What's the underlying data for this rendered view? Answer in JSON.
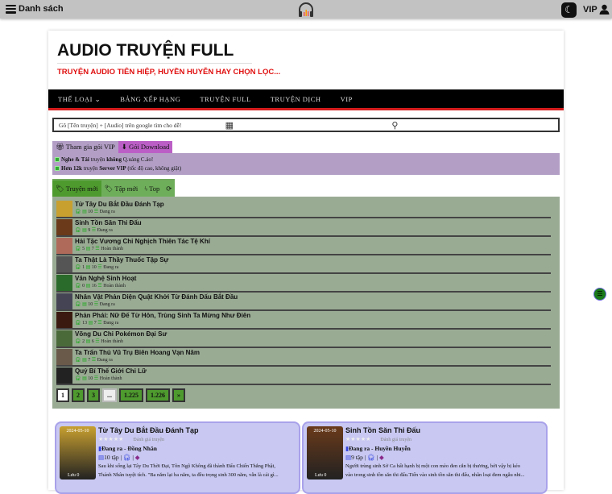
{
  "topbar": {
    "menu_label": "Danh sách",
    "vip_label": "VIP"
  },
  "header": {
    "title": "AUDIO TRUYỆN FULL",
    "tagline": "TRUYỆN AUDIO TIÊN HIỆP, HUYỀN HUYỄN HAY CHỌN LỌC..."
  },
  "nav": [
    {
      "label": "THỂ LOẠI ⌄"
    },
    {
      "label": "BẢNG XẾP HẠNG"
    },
    {
      "label": "TRUYỆN FULL"
    },
    {
      "label": "TRUYỆN DỊCH"
    },
    {
      "label": "VIP"
    }
  ],
  "search": {
    "placeholder": "Gõ [Tên truyện] + [Audio] trên google tìm cho dễ!"
  },
  "vip_tabs": [
    "Tham gia gói VIP",
    "Gói Download"
  ],
  "vip_notes": [
    {
      "bold": "Nghe & Tải",
      "mid": " truyện ",
      "bold2": "không",
      "rest": " Q.uảng C.áo!"
    },
    {
      "bold": "Hơn 12k",
      "mid": " truyện ",
      "bold2": "Server VIP",
      "rest": " (tốc độ cao, không giật)"
    }
  ],
  "list_tabs": [
    "Truyện mới",
    "Tập mới",
    "Top"
  ],
  "stories": [
    {
      "title": "Từ Tây Du Bắt Đầu Đánh Tạp",
      "listens": "",
      "chapters": "10",
      "status": "Đang ra",
      "color": "#c8a030"
    },
    {
      "title": "Sinh Tồn Săn Thi Đấu",
      "listens": "",
      "chapters": "9",
      "status": "Đang ra",
      "color": "#6a3a1a"
    },
    {
      "title": "Hải Tặc Vương Chi Nghịch Thiên Tác Tệ Khí",
      "listens": "5",
      "chapters": "7",
      "status": "Hoàn thành",
      "color": "#b06a5a"
    },
    {
      "title": "Ta Thật Là Thầy Thuốc Tập Sự",
      "listens": "1",
      "chapters": "10",
      "status": "Đang ra",
      "color": "#555"
    },
    {
      "title": "Văn Nghệ Sinh Hoạt",
      "listens": "0",
      "chapters": "16",
      "status": "Hoàn thành",
      "color": "#2a6a2a"
    },
    {
      "title": "Nhân Vật Phản Diện Quật Khởi Từ Đánh Dấu Bắt Đầu",
      "listens": "",
      "chapters": "10",
      "status": "Đang ra",
      "color": "#445"
    },
    {
      "title": "Phản Phái: Nữ Đế Từ Hôn, Trùng Sinh Ta Mừng Như Điên",
      "listens": "13",
      "chapters": "7",
      "status": "Đang ra",
      "color": "#3a1a10"
    },
    {
      "title": "Võng Du Chi Pokémon Đại Sư",
      "listens": "2",
      "chapters": "6",
      "status": "Hoàn thành",
      "color": "#4a6a3a"
    },
    {
      "title": "Ta Trấn Thủ Vũ Trụ Biên Hoang Vạn Năm",
      "listens": "",
      "chapters": "7",
      "status": "Đang ra",
      "color": "#6a5a4a"
    },
    {
      "title": "Quỷ Bí Thế Giới Chi Lữ",
      "listens": "",
      "chapters": "10",
      "status": "Hoàn thành",
      "color": "#222"
    }
  ],
  "pagination": [
    "1",
    "2",
    "3",
    "...",
    "1.225",
    "1.226",
    "»"
  ],
  "cards": [
    {
      "title": "Từ Tây Du Bắt Đầu Đánh Tạp",
      "date": "2024-05-10",
      "rating_label": "Đánh giá truyện",
      "status_genre": "Đang ra - Đồng Nhân",
      "episodes": "10 tập",
      "desc1": "Sau khi sống lại Tây Du Thời Đại, Tôn Ngộ Không đã thành Đấu Chiến Thắng Phật,",
      "desc2": "Thánh Nhân tuyệt tích. \"Ba năm lại ba năm, ta đều trọng sinh 300 năm, vẫn là cái gì...",
      "saves": "Lưu 0",
      "color": "#c8a030"
    },
    {
      "title": "Sinh Tồn Săn Thi Đấu",
      "date": "2024-05-10",
      "rating_label": "Đánh giá truyện",
      "status_genre": "Đang ra - Huyền Huyễn",
      "episodes": "9 tập",
      "desc1": "Người trùng sinh Sở Ca bất hạnh bị một con mèo đen cắn bị thương, bởi vậy bị kéo",
      "desc2": "vào trong sinh tồn săn thi đấu.Tiến vào sinh tồn săn thi đấu, nhân loại đem ngẫu nhi...",
      "saves": "Lưu 0",
      "color": "#6a3a1a"
    }
  ]
}
